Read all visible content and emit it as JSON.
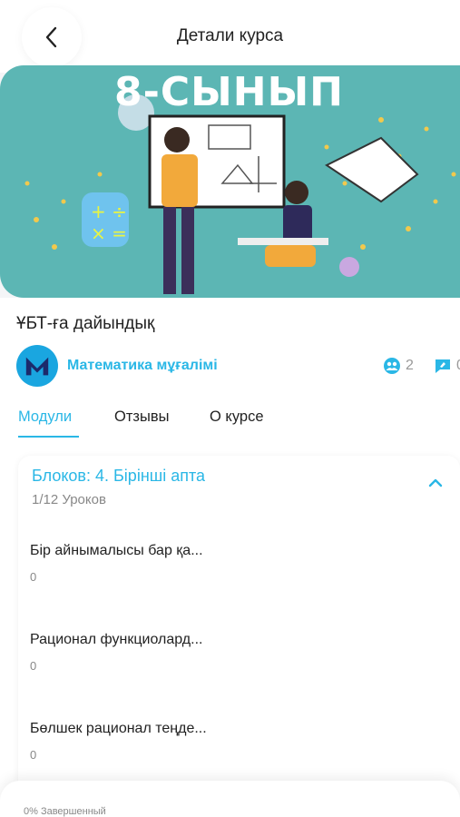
{
  "header": {
    "title": "Детали курса",
    "back_icon": "chevron-left-icon"
  },
  "banner": {
    "title": "8-СЫНЫП",
    "background": "#5cb6b4"
  },
  "course": {
    "name": "ҰБТ-ға дайындық",
    "teacher": "Математика мұғалімі",
    "students_count": "2",
    "comments_count": "0",
    "accent": "#2ab7e6"
  },
  "tabs": [
    {
      "label": "Модули",
      "active": true
    },
    {
      "label": "Отзывы",
      "active": false
    },
    {
      "label": "О курсе",
      "active": false
    }
  ],
  "module": {
    "title": "Блоков: 4. Бірінші апта",
    "lessons": "1/12 Уроков",
    "items": [
      {
        "title": "Бір айнымалысы бар қа...",
        "count": "0"
      },
      {
        "title": "Рационал функциолард...",
        "count": "0"
      },
      {
        "title": "Бөлшек рационал теңде...",
        "count": "0"
      }
    ]
  },
  "progress": {
    "label": "0% Завершенный"
  }
}
